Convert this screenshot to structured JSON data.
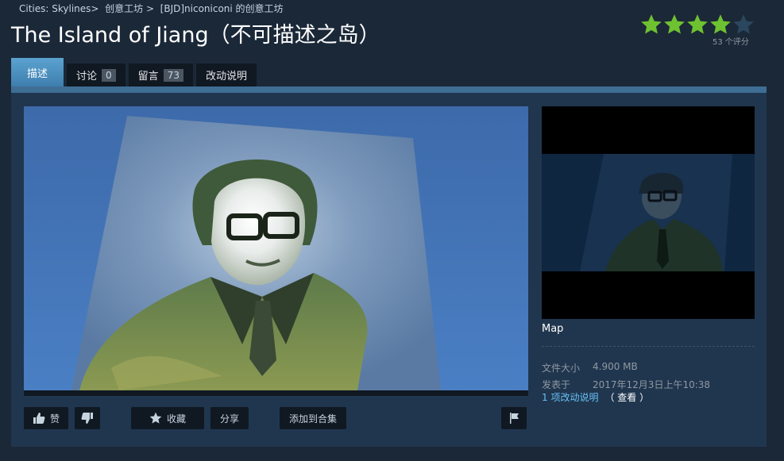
{
  "breadcrumb": {
    "game": "Cities: Skylines",
    "sep1": ">",
    "workshop": "创意工坊",
    "sep2": ">",
    "author_workshop": "[BJD]niconiconi 的创意工坊"
  },
  "title": "The Island of Jiang（不可描述之岛）",
  "rating": {
    "stars": 4,
    "max": 5,
    "count_text": "53 个评分",
    "star_color": "#6ec130",
    "empty_star_color": "#2b475e"
  },
  "tabs": [
    {
      "label": "描述",
      "active": true
    },
    {
      "label": "讨论",
      "count": "0"
    },
    {
      "label": "留言",
      "count": "73"
    },
    {
      "label": "改动说明"
    }
  ],
  "actions": {
    "like_label": "赞",
    "favorite_label": "收藏",
    "share_label": "分享",
    "add_collection_label": "添加到合集"
  },
  "details": {
    "type": "Map",
    "file_size_label": "文件大小",
    "file_size": "4.900 MB",
    "posted_label": "发表于",
    "posted": "2017年12月3日上午10:38",
    "changes_link": "1 项改动说明",
    "view_label": "（ 查看 ）"
  },
  "colors": {
    "background": "#1b2838",
    "panel": "#20364f",
    "accent": "#66c0f4",
    "tab_active": "#4a8ec0"
  }
}
